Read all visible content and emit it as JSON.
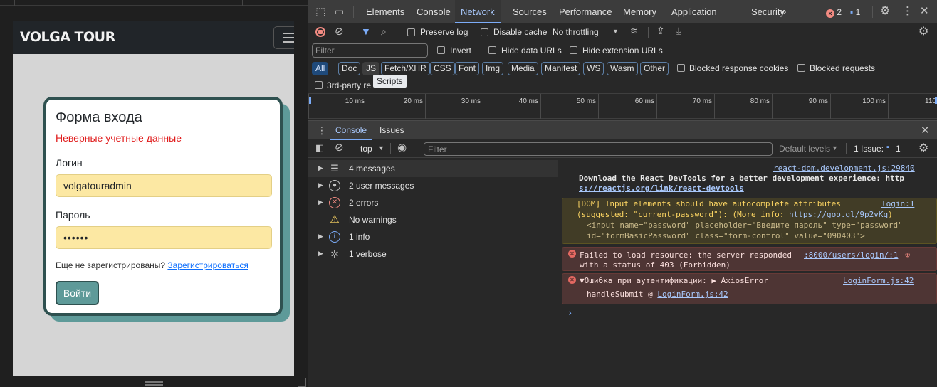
{
  "page": {
    "brand": "VOLGA TOUR",
    "form": {
      "title": "Форма входа",
      "error": "Неверные учетные данные",
      "login_label": "Логин",
      "login_value": "volgatouradmin",
      "password_label": "Пароль",
      "password_value": "••••••",
      "register_prompt": "Еще не зарегистрированы?",
      "register_link": "Зарегистрироваться",
      "submit": "Войти"
    }
  },
  "devtools": {
    "tabs": [
      "Elements",
      "Console",
      "Network",
      "Sources",
      "Performance",
      "Memory",
      "Application",
      "Security"
    ],
    "more": "»",
    "error_count": "2",
    "issue_count": "1",
    "network_toolbar": {
      "preserve_log": "Preserve log",
      "disable_cache": "Disable cache",
      "throttling": "No throttling"
    },
    "filter": {
      "placeholder": "Filter",
      "invert": "Invert",
      "hide_data_urls": "Hide data URLs",
      "hide_extension_urls": "Hide extension URLs"
    },
    "types": [
      "All",
      "Doc",
      "JS",
      "Fetch/XHR",
      "CSS",
      "Font",
      "Img",
      "Media",
      "Manifest",
      "WS",
      "Wasm",
      "Other"
    ],
    "blocked_response_cookies": "Blocked response cookies",
    "blocked_requests": "Blocked requests",
    "third_party": "3rd-party re",
    "tooltip": "Scripts",
    "timeline_ticks": [
      "10 ms",
      "20 ms",
      "30 ms",
      "40 ms",
      "50 ms",
      "60 ms",
      "70 ms",
      "80 ms",
      "90 ms",
      "100 ms",
      "110"
    ],
    "drawer_tabs": [
      "Console",
      "Issues"
    ],
    "console_toolbar": {
      "context": "top",
      "filter_placeholder": "Filter",
      "levels": "Default levels",
      "issues": "1 Issue:",
      "issues_count": "1"
    },
    "sidebar": [
      {
        "label": "4 messages",
        "icon": "list-icon"
      },
      {
        "label": "2 user messages",
        "icon": "user-icon"
      },
      {
        "label": "2 errors",
        "icon": "error-icon"
      },
      {
        "label": "No warnings",
        "icon": "warning-icon"
      },
      {
        "label": "1 info",
        "icon": "info-icon"
      },
      {
        "label": "1 verbose",
        "icon": "bug-icon"
      }
    ],
    "console": {
      "m1_src": "react-dom.development.js:29840",
      "m1_line1": "Download the React DevTools for a better development experience: http",
      "m1_link": "s://reactjs.org/link/react-devtools",
      "m2_line1": "[DOM] Input elements should have autocomplete attributes",
      "m2_src": "login:1",
      "m2_line2a": "(suggested: \"current-password\"): (More info: ",
      "m2_link": "https://goo.gl/9p2vKq",
      "m2_line2b": ")",
      "m2_line3": "<input name=\"password\" placeholder=\"Введите пароль\" type=\"password\"",
      "m2_line4": "id=\"formBasicPassword\" class=\"form-control\" value=\"090403\">",
      "m3_line1": "Failed to load resource: the server responded",
      "m3_src": ":8000/users/login/:1",
      "m3_line2": "with a status of 403 (Forbidden)",
      "m4_line1": "▼Ошибка при аутентификации: ▶ AxiosError",
      "m4_src": "LoginForm.js:42",
      "m4_line2": "handleSubmit @ ",
      "m4_link": "LoginForm.js:42",
      "prompt": "›"
    }
  }
}
